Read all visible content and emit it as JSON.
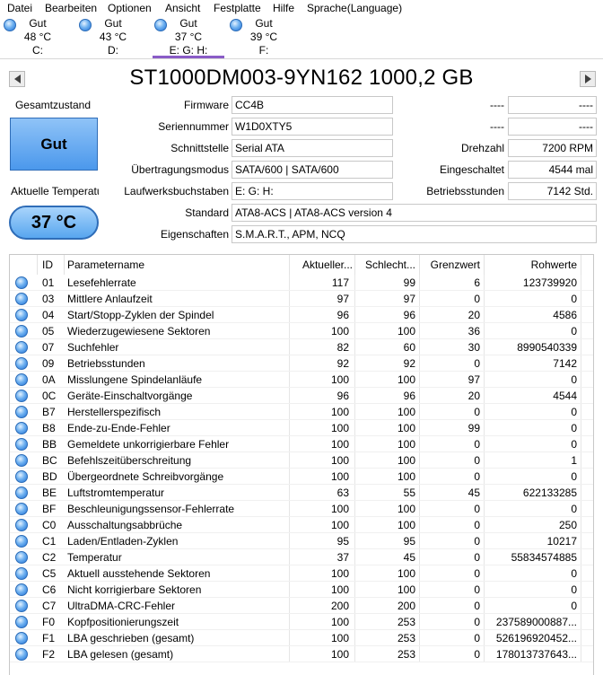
{
  "menu": [
    "Datei",
    "Bearbeiten",
    "Optionen",
    "Ansicht",
    "Festplatte",
    "Hilfe",
    "Sprache(Language)"
  ],
  "drives": [
    {
      "status": "Gut",
      "temp": "48 °C",
      "letter": "C:"
    },
    {
      "status": "Gut",
      "temp": "43 °C",
      "letter": "D:"
    },
    {
      "status": "Gut",
      "temp": "37 °C",
      "letter": "E: G: H:"
    },
    {
      "status": "Gut",
      "temp": "39 °C",
      "letter": "F:"
    }
  ],
  "active_drive": 2,
  "title": "ST1000DM003-9YN162 1000,2 GB",
  "health": {
    "label": "Gesamtzustand",
    "value": "Gut"
  },
  "temperature": {
    "label": "Aktuelle Temperatur",
    "value": "37 °C"
  },
  "fields_left": [
    {
      "label": "Firmware",
      "value": "CC4B"
    },
    {
      "label": "Seriennummer",
      "value": "W1D0XTY5"
    },
    {
      "label": "Schnittstelle",
      "value": "Serial ATA"
    },
    {
      "label": "Übertragungsmodus",
      "value": "SATA/600 | SATA/600"
    },
    {
      "label": "Laufwerksbuchstaben",
      "value": "E: G: H:"
    },
    {
      "label": "Standard",
      "value": "ATA8-ACS | ATA8-ACS version 4"
    },
    {
      "label": "Eigenschaften",
      "value": "S.M.A.R.T., APM, NCQ"
    }
  ],
  "fields_right": [
    {
      "label": "----",
      "value": "----"
    },
    {
      "label": "----",
      "value": "----"
    },
    {
      "label": "Drehzahl",
      "value": "7200 RPM"
    },
    {
      "label": "Eingeschaltet",
      "value": "4544 mal"
    },
    {
      "label": "Betriebsstunden",
      "value": "7142 Std."
    }
  ],
  "table": {
    "headers": [
      "ID",
      "Parametername",
      "Aktueller...",
      "Schlecht...",
      "Grenzwert",
      "Rohwerte"
    ],
    "rows": [
      [
        "01",
        "Lesefehlerrate",
        "117",
        "99",
        "6",
        "123739920"
      ],
      [
        "03",
        "Mittlere Anlaufzeit",
        "97",
        "97",
        "0",
        "0"
      ],
      [
        "04",
        "Start/Stopp-Zyklen der Spindel",
        "96",
        "96",
        "20",
        "4586"
      ],
      [
        "05",
        "Wiederzugewiesene Sektoren",
        "100",
        "100",
        "36",
        "0"
      ],
      [
        "07",
        "Suchfehler",
        "82",
        "60",
        "30",
        "8990540339"
      ],
      [
        "09",
        "Betriebsstunden",
        "92",
        "92",
        "0",
        "7142"
      ],
      [
        "0A",
        "Misslungene Spindelanläufe",
        "100",
        "100",
        "97",
        "0"
      ],
      [
        "0C",
        "Geräte-Einschaltvorgänge",
        "96",
        "96",
        "20",
        "4544"
      ],
      [
        "B7",
        "Herstellerspezifisch",
        "100",
        "100",
        "0",
        "0"
      ],
      [
        "B8",
        "Ende-zu-Ende-Fehler",
        "100",
        "100",
        "99",
        "0"
      ],
      [
        "BB",
        "Gemeldete unkorrigierbare Fehler",
        "100",
        "100",
        "0",
        "0"
      ],
      [
        "BC",
        "Befehlszeitüberschreitung",
        "100",
        "100",
        "0",
        "1"
      ],
      [
        "BD",
        "Übergeordnete Schreibvorgänge",
        "100",
        "100",
        "0",
        "0"
      ],
      [
        "BE",
        "Luftstromtemperatur",
        "63",
        "55",
        "45",
        "622133285"
      ],
      [
        "BF",
        "Beschleunigungssensor-Fehlerrate",
        "100",
        "100",
        "0",
        "0"
      ],
      [
        "C0",
        "Ausschaltungsabbrüche",
        "100",
        "100",
        "0",
        "250"
      ],
      [
        "C1",
        "Laden/Entladen-Zyklen",
        "95",
        "95",
        "0",
        "10217"
      ],
      [
        "C2",
        "Temperatur",
        "37",
        "45",
        "0",
        "55834574885"
      ],
      [
        "C5",
        "Aktuell ausstehende Sektoren",
        "100",
        "100",
        "0",
        "0"
      ],
      [
        "C6",
        "Nicht korrigierbare Sektoren",
        "100",
        "100",
        "0",
        "0"
      ],
      [
        "C7",
        "UltraDMA-CRC-Fehler",
        "200",
        "200",
        "0",
        "0"
      ],
      [
        "F0",
        "Kopfpositionierungszeit",
        "100",
        "253",
        "0",
        "237589000887..."
      ],
      [
        "F1",
        "LBA geschrieben (gesamt)",
        "100",
        "253",
        "0",
        "526196920452..."
      ],
      [
        "F2",
        "LBA gelesen (gesamt)",
        "100",
        "253",
        "0",
        "178013737643..."
      ]
    ]
  }
}
